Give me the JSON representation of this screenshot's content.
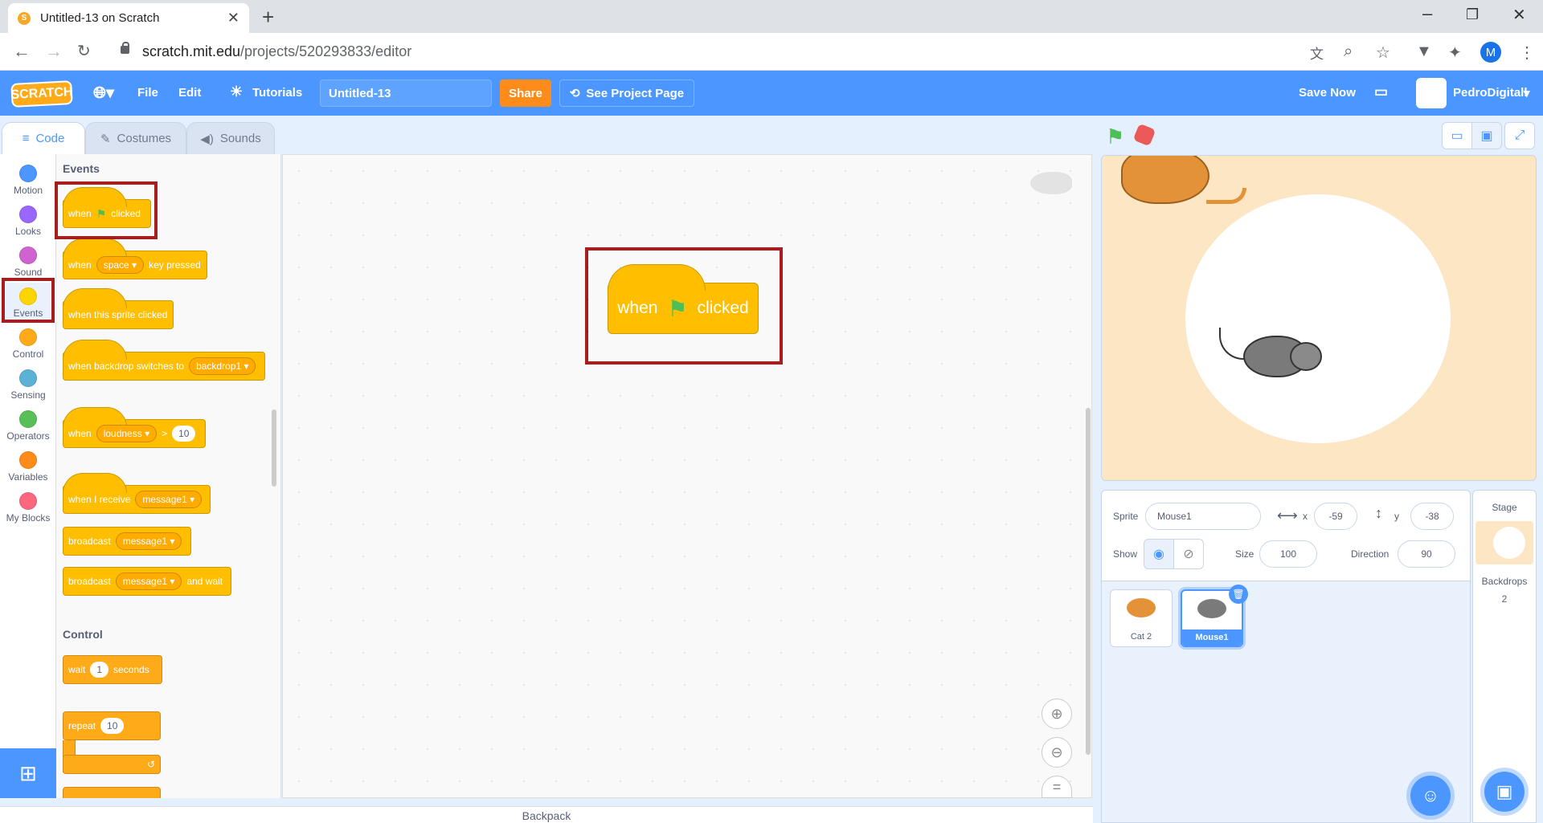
{
  "browser": {
    "tab_title": "Untitled-13 on Scratch",
    "url_host": "scratch.mit.edu",
    "url_path": "/projects/520293833/editor",
    "profile_initial": "M"
  },
  "menubar": {
    "logo": "SCRATCH",
    "file": "File",
    "edit": "Edit",
    "tutorials": "Tutorials",
    "project_title": "Untitled-13",
    "share": "Share",
    "see_project": "See Project Page",
    "save_now": "Save Now",
    "username": "PedroDigitall"
  },
  "editor_tabs": {
    "code": "Code",
    "costumes": "Costumes",
    "sounds": "Sounds"
  },
  "categories": [
    {
      "label": "Motion",
      "color": "#4c97ff"
    },
    {
      "label": "Looks",
      "color": "#9966ff"
    },
    {
      "label": "Sound",
      "color": "#cf63cf"
    },
    {
      "label": "Events",
      "color": "#ffd500"
    },
    {
      "label": "Control",
      "color": "#ffab19"
    },
    {
      "label": "Sensing",
      "color": "#5cb1d6"
    },
    {
      "label": "Operators",
      "color": "#59c059"
    },
    {
      "label": "Variables",
      "color": "#ff8c1a"
    },
    {
      "label": "My Blocks",
      "color": "#ff6680"
    }
  ],
  "flyout": {
    "events_heading": "Events",
    "control_heading": "Control",
    "when": "when",
    "clicked": "clicked",
    "space": "space",
    "key_pressed": "key pressed",
    "sprite_clicked": "when this sprite clicked",
    "backdrop_switches": "when backdrop switches to",
    "backdrop1": "backdrop1",
    "loudness": "loudness",
    "gt": ">",
    "loudness_value": "10",
    "when_i_receive": "when I receive",
    "message1": "message1",
    "broadcast": "broadcast",
    "and_wait": "and wait",
    "wait": "wait",
    "wait_value": "1",
    "seconds": "seconds",
    "repeat": "repeat",
    "repeat_value": "10"
  },
  "script": {
    "when": "when",
    "clicked": "clicked"
  },
  "backpack": "Backpack",
  "sprite_info": {
    "sprite_label": "Sprite",
    "sprite_name": "Mouse1",
    "x_label": "x",
    "x_value": "-59",
    "y_label": "y",
    "y_value": "-38",
    "show_label": "Show",
    "size_label": "Size",
    "size_value": "100",
    "direction_label": "Direction",
    "direction_value": "90"
  },
  "sprites": [
    {
      "name": "Cat 2",
      "color": "#e39238"
    },
    {
      "name": "Mouse1",
      "color": "#7a7a7a"
    }
  ],
  "stage_pane": {
    "title": "Stage",
    "backdrops_label": "Backdrops",
    "backdrops_count": "2"
  },
  "colors": {
    "accent": "#4c97ff",
    "events_block": "#ffbf00",
    "highlight": "#a51d1d"
  }
}
